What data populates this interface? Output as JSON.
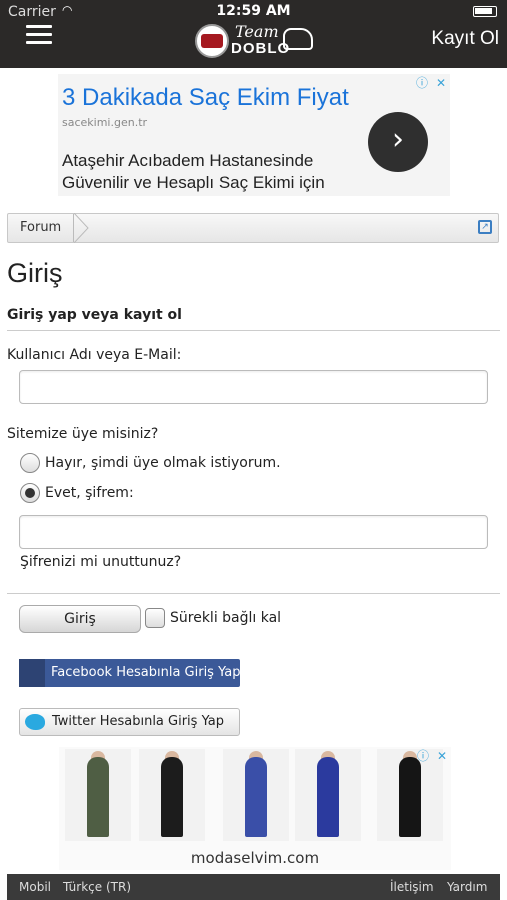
{
  "status_bar": {
    "carrier": "Carrier",
    "time": "12:59 AM"
  },
  "header": {
    "logo_top": "Team",
    "logo_bottom": "DOBLO",
    "register_label": "Kayıt Ol"
  },
  "ad_top": {
    "title": "3 Dakikada Saç Ekim Fiyat",
    "url": "sacekimi.gen.tr",
    "description": "Ataşehir Acıbadem Hastanesinde Güvenilir ve Hesaplı Saç Ekimi için",
    "arrow": "›",
    "info_icon": "ⓘ",
    "close_icon": "✕"
  },
  "breadcrumb": {
    "item": "Forum",
    "external_icon": "↗"
  },
  "page": {
    "title": "Giriş",
    "subtitle": "Giriş yap veya kayıt ol",
    "username_label": "Kullanıcı Adı veya E-Mail:",
    "username_value": "",
    "member_question": "Sitemize üye misiniz?",
    "option_no": "Hayır, şimdi üye olmak istiyorum.",
    "option_yes": "Evet, şifrem:",
    "selected_option": "yes",
    "password_value": "",
    "forgot_password": "Şifrenizi mi unuttunuz?",
    "login_button": "Giriş",
    "stay_logged_in": "Sürekli bağlı kal",
    "stay_logged_in_checked": false,
    "facebook_button": "Facebook Hesabınla Giriş Yap",
    "twitter_button": "Twitter Hesabınla Giriş Yap"
  },
  "ad_bottom": {
    "site": "modaselvim.com",
    "dress_colors": [
      "#4f5e44",
      "#1c1c1c",
      "#3a4fa8",
      "#2b3a9e",
      "#151515"
    ],
    "info_icon": "ⓘ",
    "close_icon": "✕"
  },
  "footer": {
    "mobile": "Mobil",
    "language": "Türkçe (TR)",
    "contact": "İletişim",
    "help": "Yardım"
  }
}
